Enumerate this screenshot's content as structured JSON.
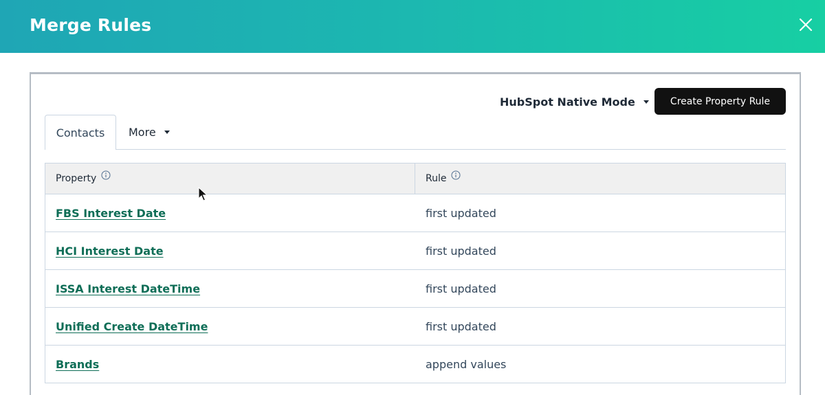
{
  "modal": {
    "title": "Merge Rules"
  },
  "toolbar": {
    "mode_label": "HubSpot Native Mode",
    "create_button_label": "Create Property Rule"
  },
  "tabs": [
    {
      "label": "Contacts",
      "active": true
    },
    {
      "label": "More",
      "active": false
    }
  ],
  "table": {
    "headers": {
      "property": "Property",
      "rule": "Rule"
    },
    "rows": [
      {
        "property": "FBS Interest Date",
        "rule": "first updated"
      },
      {
        "property": "HCI Interest Date",
        "rule": "first updated"
      },
      {
        "property": "ISSA Interest DateTime",
        "rule": "first updated"
      },
      {
        "property": "Unified Create DateTime",
        "rule": "first updated"
      },
      {
        "property": "Brands",
        "rule": "append values"
      }
    ]
  },
  "colors": {
    "header_gradient_start": "#1fa6b5",
    "header_gradient_end": "#17cfa3",
    "link": "#0f6e57",
    "button_bg": "#111111"
  },
  "icons": {
    "close": "close-icon",
    "info": "info-icon",
    "caret": "caret-down-icon"
  }
}
